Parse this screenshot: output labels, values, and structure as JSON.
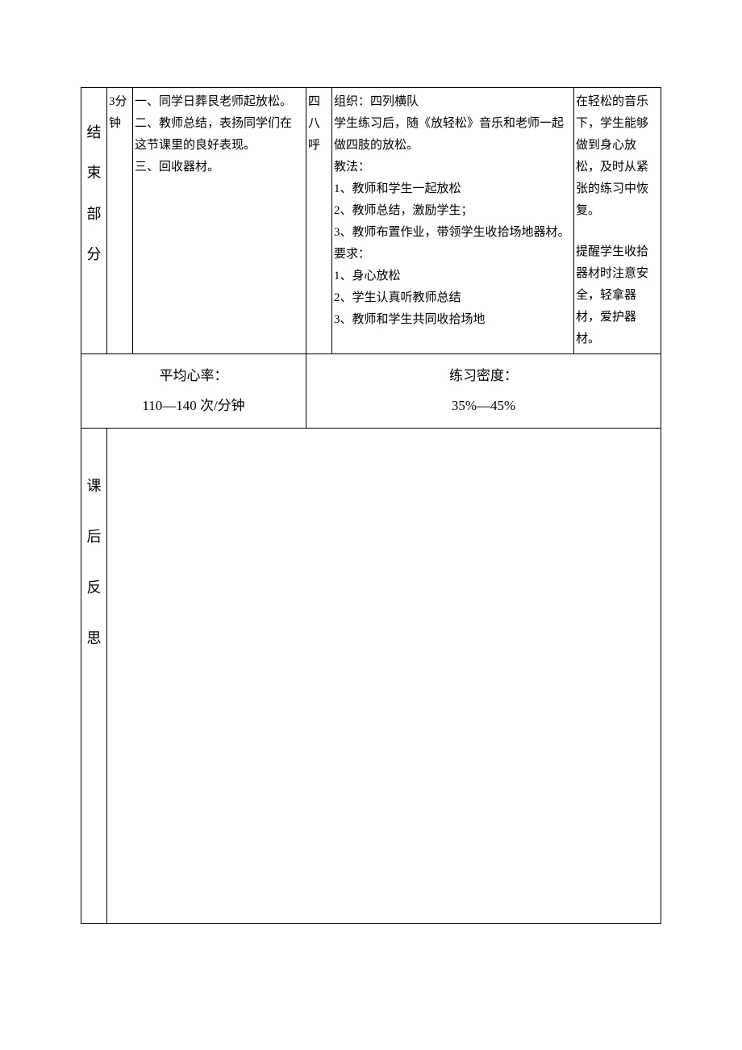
{
  "row1": {
    "sectionLabel": "结束部分",
    "time": "3分钟",
    "content": {
      "l1": "一、同学日葬艮老师起放松。",
      "l2": "二、教师总结，表扬同学们在",
      "l3": "这节课里的良好表现。",
      "l4": "三、回收器材。"
    },
    "count": "四八呼",
    "method": {
      "l1": "组织：四列横队",
      "l2": "    学生练习后，随《放轻松》音乐和老师一起做四肢的放松。",
      "l3": "    教法：",
      "l4": "1、教师和学生一起放松",
      "l5": "2、教师总结，激励学生；",
      "l6": "3、教师布置作业，带领学生收拾场地器材。",
      "l7": "要求：",
      "l8": "1、身心放松",
      "l9": "2、学生认真听教师总结",
      "l10": "3、教师和学生共同收拾场地"
    },
    "note": {
      "l1": "在轻松的音乐下，学生能够做到身心放松，及时从紧张的练习中恢复。",
      "l2": "提醒学生收拾器材时注意安全，轻拿器材，爱护器材。"
    }
  },
  "row2": {
    "hrLabel": "平均心率：",
    "hrValue": "110—140 次/分钟",
    "densityLabel": "练习密度：",
    "densityValue": "35%—45%"
  },
  "row3": {
    "label": "课后反思"
  }
}
